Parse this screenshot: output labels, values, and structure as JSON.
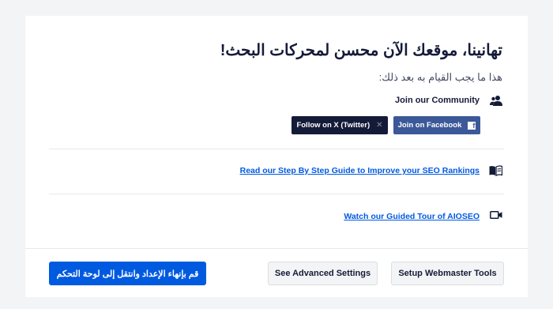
{
  "header": {
    "title": "تهانينا، موقعك الآن محسن لمحركات البحث!",
    "subtitle": "هذا ما يجب القيام به بعد ذلك:"
  },
  "community": {
    "label": "Join our Community",
    "icon": "users-icon",
    "facebook_label": "Join on Facebook",
    "facebook_icon": "facebook-icon",
    "x_label": "Follow on X (Twitter)",
    "x_icon": "x-twitter-icon",
    "facebook_color": "#3b5998",
    "x_color": "#141b38"
  },
  "links": {
    "guide_label": "Read our Step By Step Guide to Improve your SEO Rankings",
    "guide_icon": "book-open-icon",
    "tour_label": "Watch our Guided Tour of AIOSEO",
    "tour_icon": "video-camera-icon",
    "link_color": "#005ae0"
  },
  "footer": {
    "webmaster_label": "Setup Webmaster Tools",
    "advanced_label": "See Advanced Settings",
    "finish_label": "قم بإنهاء الإعداد وانتقل إلى لوحة التحكم",
    "primary_color": "#005ae0"
  }
}
